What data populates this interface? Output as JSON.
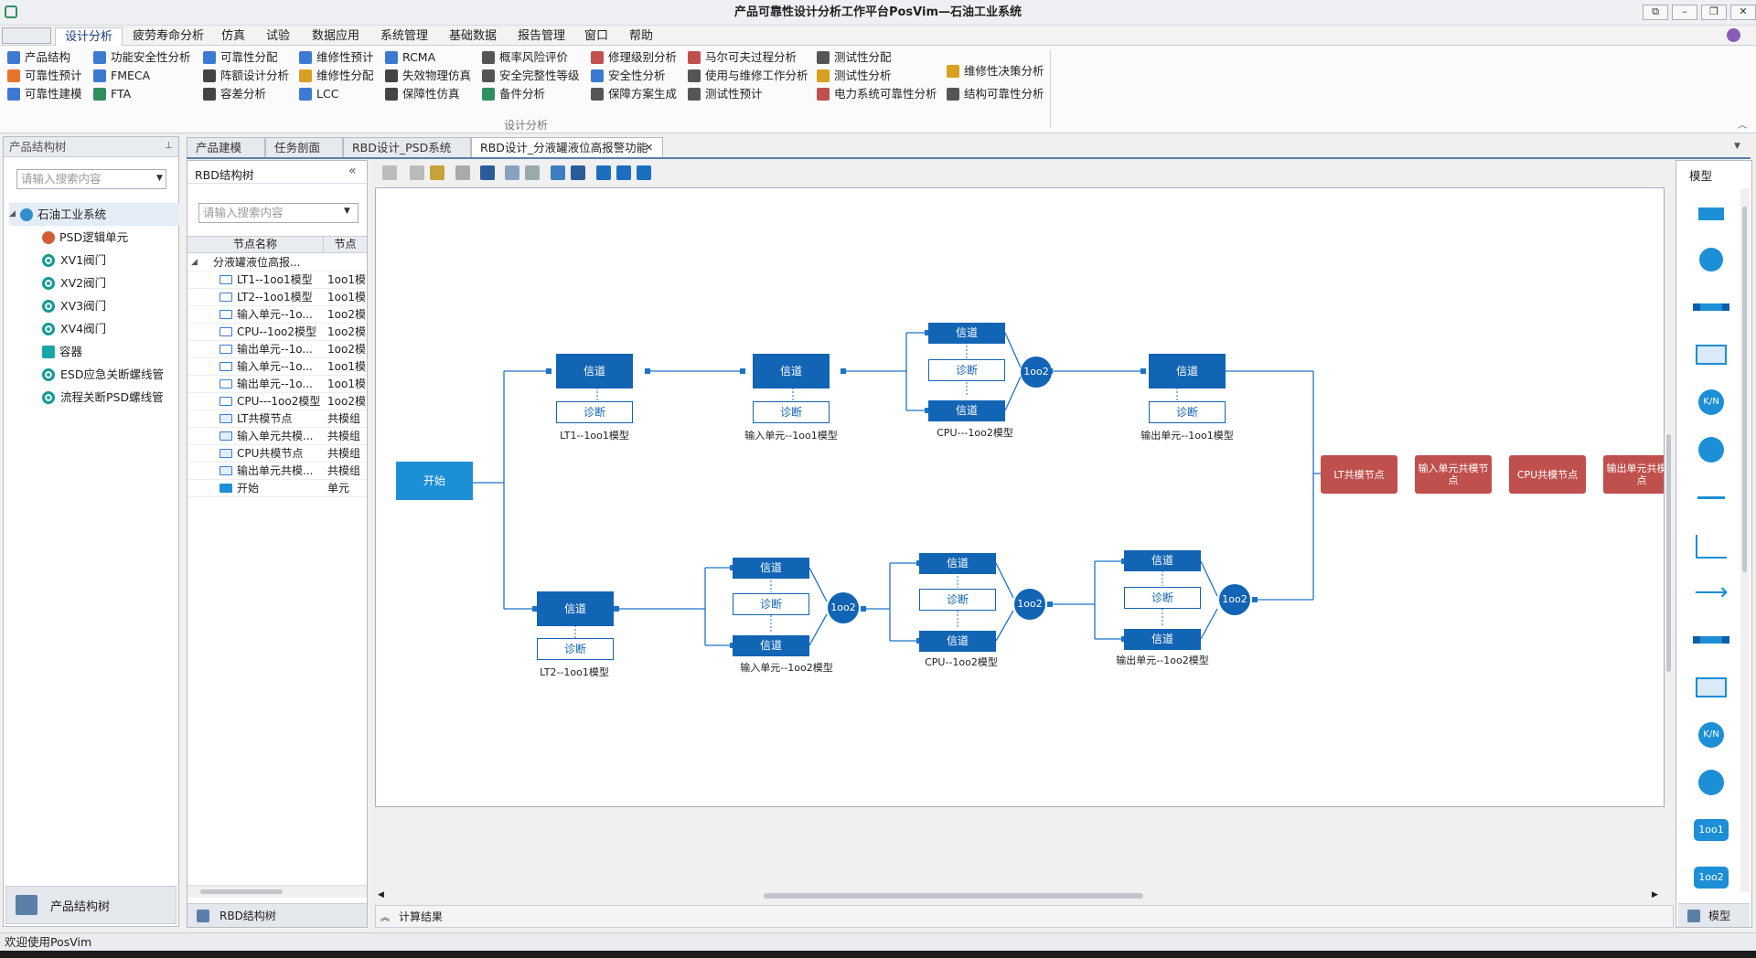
{
  "app": {
    "title": "产品可靠性设计分析工作平台PosVim—石油工业系统"
  },
  "window": {
    "btn1": "⧉",
    "btn2": "–",
    "btn3": "❐",
    "btn4": "✕"
  },
  "menus": [
    "设计分析",
    "疲劳寿命分析",
    "仿真",
    "试验",
    "数据应用",
    "系统管理",
    "基础数据",
    "报告管理",
    "窗口",
    "帮助"
  ],
  "ribbon": {
    "group": "设计分析",
    "c1": [
      "产品结构",
      "可靠性预计",
      "可靠性建模"
    ],
    "c2": [
      "功能安全性分析",
      "FMECA",
      "FTA"
    ],
    "c3": [
      "可靠性分配",
      "阵额设计分析",
      "容差分析"
    ],
    "c4": [
      "维修性预计",
      "维修性分配",
      "LCC"
    ],
    "c5": [
      "RCMA",
      "失效物理仿真",
      "保障性仿真"
    ],
    "c6": [
      "概率风险评价",
      "安全完整性等级",
      "备件分析"
    ],
    "c7": [
      "修理级别分析",
      "安全性分析",
      "保障方案生成"
    ],
    "c8": [
      "马尔可夫过程分析",
      "使用与维修工作分析",
      "测试性预计"
    ],
    "c9": [
      "测试性分配",
      "测试性分析",
      "电力系统可靠性分析"
    ],
    "c10": [
      "维修性决策分析",
      "结构可靠性分析"
    ]
  },
  "left_panel": {
    "title": "产品结构树",
    "search": "请输入搜索内容",
    "root": "石油工业系统",
    "items": [
      "PSD逻辑单元",
      "XV1阀门",
      "XV2阀门",
      "XV3阀门",
      "XV4阀门",
      "容器",
      "ESD应急关断螺线管",
      "流程关断PSD螺线管"
    ],
    "footer": "产品结构树"
  },
  "tabs": [
    "产品建模",
    "任务剖面",
    "RBD设计_PSD系统",
    "RBD设计_分液罐液位高报警功能"
  ],
  "rbd_tree": {
    "title": "RBD结构树",
    "collapse": "«",
    "search": "请输入搜索内容",
    "col1": "节点名称",
    "col2": "节点",
    "root": "分液罐液位高报...",
    "rows": [
      [
        "LT1--1oo1模型",
        "1oo1模"
      ],
      [
        "LT2--1oo1模型",
        "1oo1模"
      ],
      [
        "输入单元--1o...",
        "1oo2模"
      ],
      [
        "CPU--1oo2模型",
        "1oo2模"
      ],
      [
        "输出单元--1o...",
        "1oo2模"
      ],
      [
        "输入单元--1o...",
        "1oo1模"
      ],
      [
        "输出单元--1o...",
        "1oo1模"
      ],
      [
        "CPU---1oo2模型",
        "1oo2模"
      ],
      [
        "LT共模节点",
        "共模组"
      ],
      [
        "输入单元共模...",
        "共模组"
      ],
      [
        "CPU共模节点",
        "共模组"
      ],
      [
        "输出单元共模...",
        "共模组"
      ],
      [
        "开始",
        "单元"
      ]
    ],
    "footer": "RBD结构树"
  },
  "diagram": {
    "start": "开始",
    "ch": "信道",
    "diag": "诊断",
    "vote": "1oo2",
    "labels": {
      "lt1": "LT1--1oo1模型",
      "in1": "输入单元--1oo1模型",
      "cpu1": "CPU---1oo2模型",
      "out1": "输出单元--1oo1模型",
      "lt2": "LT2--1oo1模型",
      "in2": "输入单元--1oo2模型",
      "cpu2": "CPU--1oo2模型",
      "out2": "输出单元--1oo2模型"
    },
    "common": [
      "LT共模节点",
      "输入单元共模节点",
      "CPU共模节点",
      "输出单元共模节点"
    ]
  },
  "bottom": {
    "calc": "计算结果"
  },
  "palette": {
    "title": "模型",
    "kn": "K/N",
    "o1": "1oo1",
    "o2": "1oo2",
    "footer": "模型"
  },
  "status": "欢迎使用PosVim"
}
